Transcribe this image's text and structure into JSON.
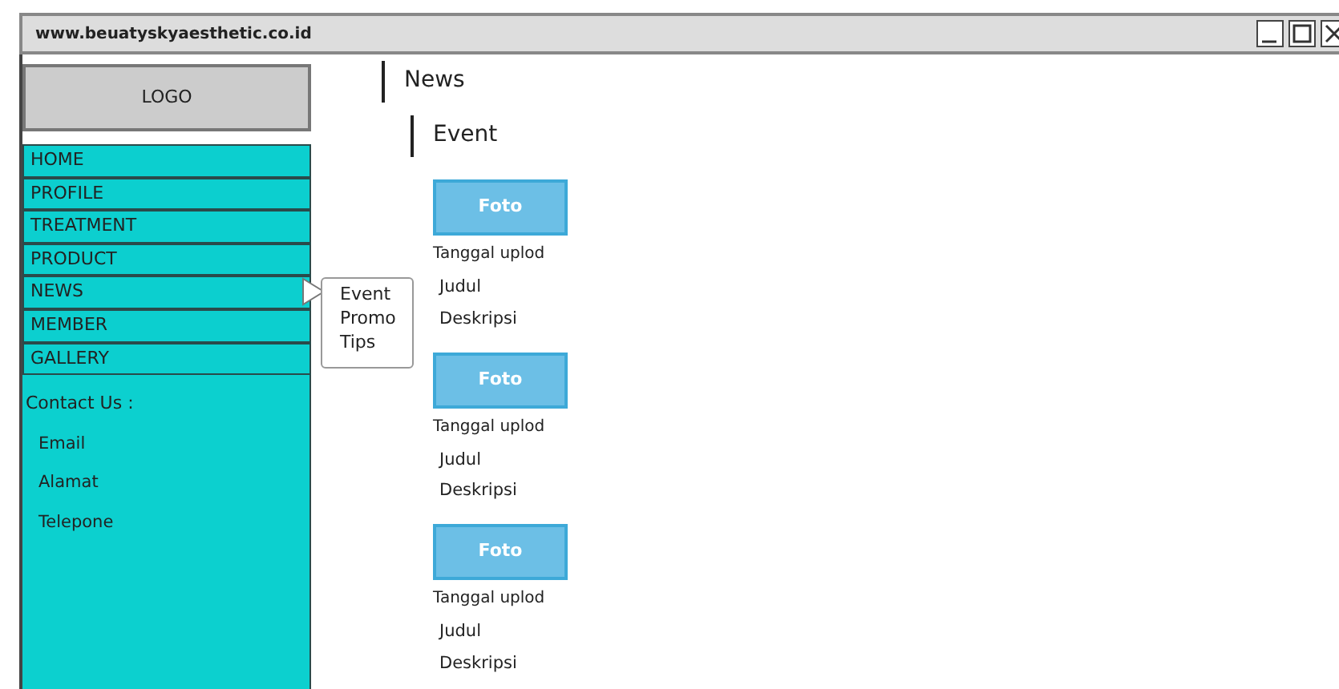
{
  "window": {
    "url": "www.beuatyskyaesthetic.co.id"
  },
  "sidebar": {
    "logo": "LOGO",
    "menu": [
      {
        "label": "HOME",
        "expanded": false
      },
      {
        "label": "PROFILE",
        "expanded": false
      },
      {
        "label": "TREATMENT",
        "expanded": false
      },
      {
        "label": "PRODUCT",
        "expanded": false
      },
      {
        "label": "NEWS",
        "expanded": true,
        "children": [
          {
            "label": "Event"
          },
          {
            "label": "Promo"
          },
          {
            "label": "Tips"
          }
        ]
      },
      {
        "label": "MEMBER",
        "expanded": false
      },
      {
        "label": "GALLERY",
        "expanded": false
      }
    ],
    "contact": {
      "title": "Contact Us :",
      "items": [
        "Email",
        "Alamat",
        "Telepone"
      ]
    }
  },
  "content": {
    "heading": "News",
    "subheading": "Event",
    "posts": [
      {
        "image": "Foto",
        "date": "Tanggal uplod",
        "title": "Judul",
        "description": "Deskripsi"
      },
      {
        "image": "Foto",
        "date": "Tanggal uplod",
        "title": "Judul",
        "description": "Deskripsi"
      },
      {
        "image": "Foto",
        "date": "Tanggal uplod",
        "title": "Judul",
        "description": "Deskripsi"
      }
    ]
  }
}
